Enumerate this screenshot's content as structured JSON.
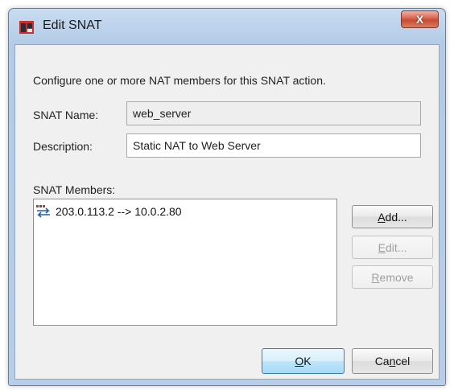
{
  "window": {
    "title": "Edit SNAT",
    "close_label": "X"
  },
  "form": {
    "instructions": "Configure one or more NAT members for this SNAT action.",
    "name_label": "SNAT Name:",
    "name_value": "web_server",
    "description_label": "Description:",
    "description_value": "Static NAT to Web Server",
    "members_label": "SNAT Members:",
    "members": [
      {
        "text": "203.0.113.2 --> 10.0.2.80",
        "icon": "nat-mapping-icon"
      }
    ]
  },
  "buttons": {
    "add_mnemonic": "A",
    "add_rest": "dd...",
    "edit_mnemonic": "E",
    "edit_rest": "dit...",
    "remove_mnemonic": "R",
    "remove_rest": "emove",
    "ok_mnemonic": "O",
    "ok_rest": "K",
    "cancel_pre": "Ca",
    "cancel_mnemonic": "n",
    "cancel_post": "cel"
  },
  "colors": {
    "titlebar": "#b3cbe6",
    "close_button": "#d9614a",
    "default_button_border": "#3c7fb1"
  }
}
